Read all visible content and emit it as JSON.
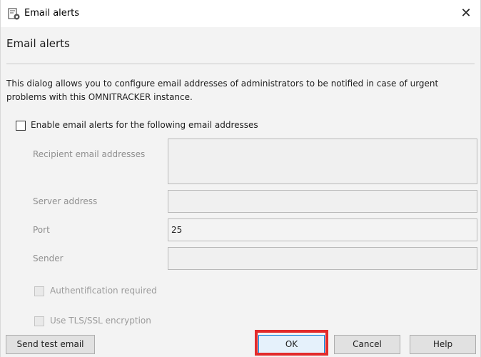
{
  "window": {
    "title": "Email alerts",
    "title_icon": "settings-dialog-icon",
    "close_symbol": "✕"
  },
  "dialog": {
    "heading": "Email alerts",
    "description": "This dialog allows you to configure email addresses of administrators to be notified in case of urgent problems with this OMNITRACKER instance."
  },
  "enable_checkbox": {
    "label": "Enable email alerts for the following email addresses",
    "checked": false
  },
  "fields": {
    "recipients": {
      "label": "Recipient email addresses",
      "value": ""
    },
    "server": {
      "label": "Server address",
      "value": ""
    },
    "port": {
      "label": "Port",
      "value": "25"
    },
    "sender": {
      "label": "Sender",
      "value": ""
    }
  },
  "options": {
    "auth": {
      "label": "Authentification required",
      "checked": false,
      "enabled": false
    },
    "tls": {
      "label": "Use TLS/SSL encryption",
      "checked": false,
      "enabled": false
    }
  },
  "buttons": {
    "send_test": "Send test email",
    "ok": "OK",
    "cancel": "Cancel",
    "help": "Help"
  },
  "colors": {
    "highlight": "#e22b2b",
    "default_button_border": "#0078d7"
  }
}
